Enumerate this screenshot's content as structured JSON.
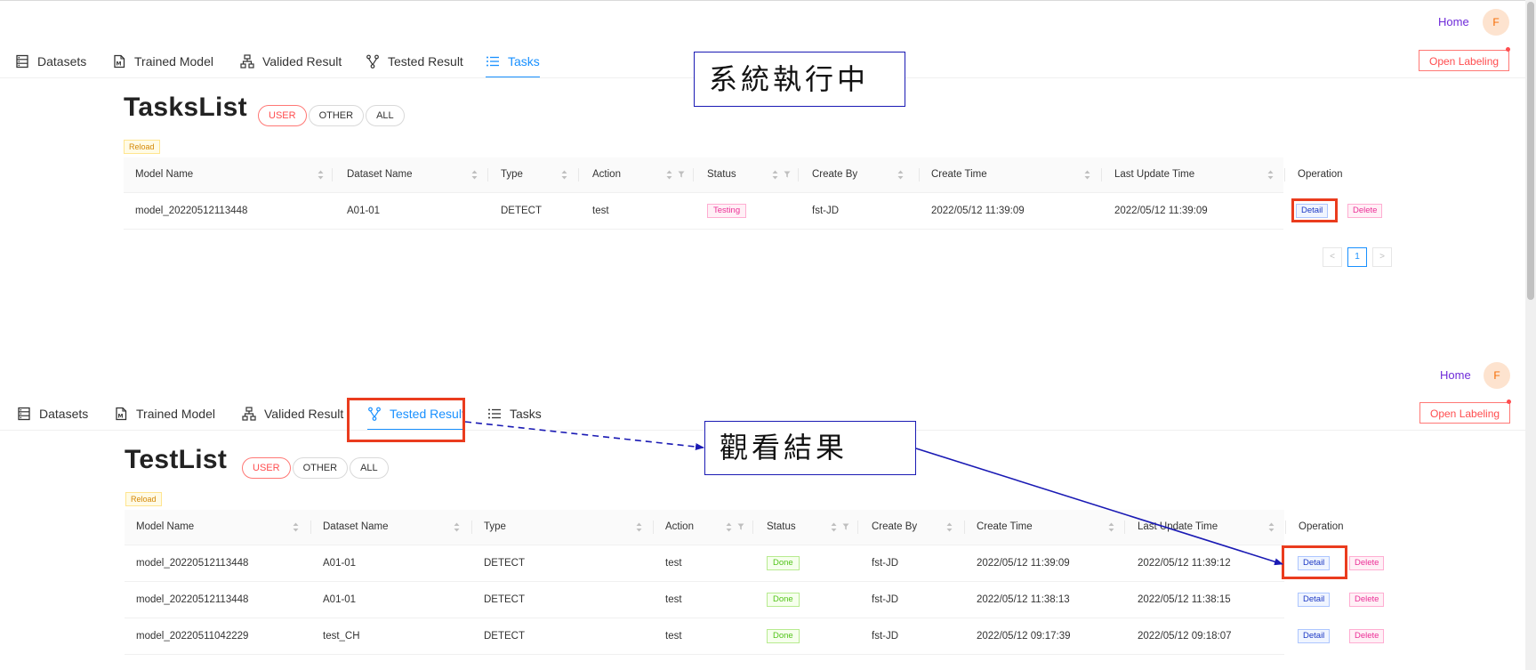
{
  "nav": {
    "home_label": "Home",
    "avatar_initial": "F",
    "open_labeling_label": "Open Labeling",
    "tabs": [
      {
        "label": "Datasets",
        "icon": "database-icon"
      },
      {
        "label": "Trained Model",
        "icon": "model-file-icon"
      },
      {
        "label": "Valided Result",
        "icon": "hierarchy-icon"
      },
      {
        "label": "Tested Result",
        "icon": "branch-icon"
      },
      {
        "label": "Tasks",
        "icon": "list-icon"
      }
    ]
  },
  "filters": [
    "USER",
    "OTHER",
    "ALL"
  ],
  "reload_label": "Reload",
  "annotations": {
    "system_running": "系統執行中",
    "view_result": "觀看結果"
  },
  "colors": {
    "primary": "#1890ff",
    "accent_red": "#ff4d4f",
    "annotation_box": "#1a1ab4",
    "highlight_box": "#ea3c1e"
  },
  "tasks_list": {
    "title": "TasksList",
    "active_tab": "Tasks",
    "active_filter": "USER",
    "columns": [
      "Model Name",
      "Dataset Name",
      "Type",
      "Action",
      "Status",
      "Create By",
      "Create Time",
      "Last Update Time",
      "Operation"
    ],
    "rows": [
      {
        "model_name": "model_20220512113448",
        "dataset_name": "A01-01",
        "type": "DETECT",
        "action": "test",
        "status": "Testing",
        "create_by": "fst-JD",
        "create_time": "2022/05/12 11:39:09",
        "last_update_time": "2022/05/12 11:39:09",
        "detail_label": "Detail",
        "delete_label": "Delete"
      }
    ],
    "pagination": {
      "prev": "<",
      "current": "1",
      "next": ">"
    }
  },
  "test_list": {
    "title": "TestList",
    "active_tab": "Tested Result",
    "active_filter": "USER",
    "columns": [
      "Model Name",
      "Dataset Name",
      "Type",
      "Action",
      "Status",
      "Create By",
      "Create Time",
      "Last Update Time",
      "Operation"
    ],
    "rows": [
      {
        "model_name": "model_20220512113448",
        "dataset_name": "A01-01",
        "type": "DETECT",
        "action": "test",
        "status": "Done",
        "create_by": "fst-JD",
        "create_time": "2022/05/12 11:39:09",
        "last_update_time": "2022/05/12 11:39:12",
        "detail_label": "Detail",
        "delete_label": "Delete"
      },
      {
        "model_name": "model_20220512113448",
        "dataset_name": "A01-01",
        "type": "DETECT",
        "action": "test",
        "status": "Done",
        "create_by": "fst-JD",
        "create_time": "2022/05/12 11:38:13",
        "last_update_time": "2022/05/12 11:38:15",
        "detail_label": "Detail",
        "delete_label": "Delete"
      },
      {
        "model_name": "model_20220511042229",
        "dataset_name": "test_CH",
        "type": "DETECT",
        "action": "test",
        "status": "Done",
        "create_by": "fst-JD",
        "create_time": "2022/05/12 09:17:39",
        "last_update_time": "2022/05/12 09:18:07",
        "detail_label": "Detail",
        "delete_label": "Delete"
      }
    ]
  }
}
